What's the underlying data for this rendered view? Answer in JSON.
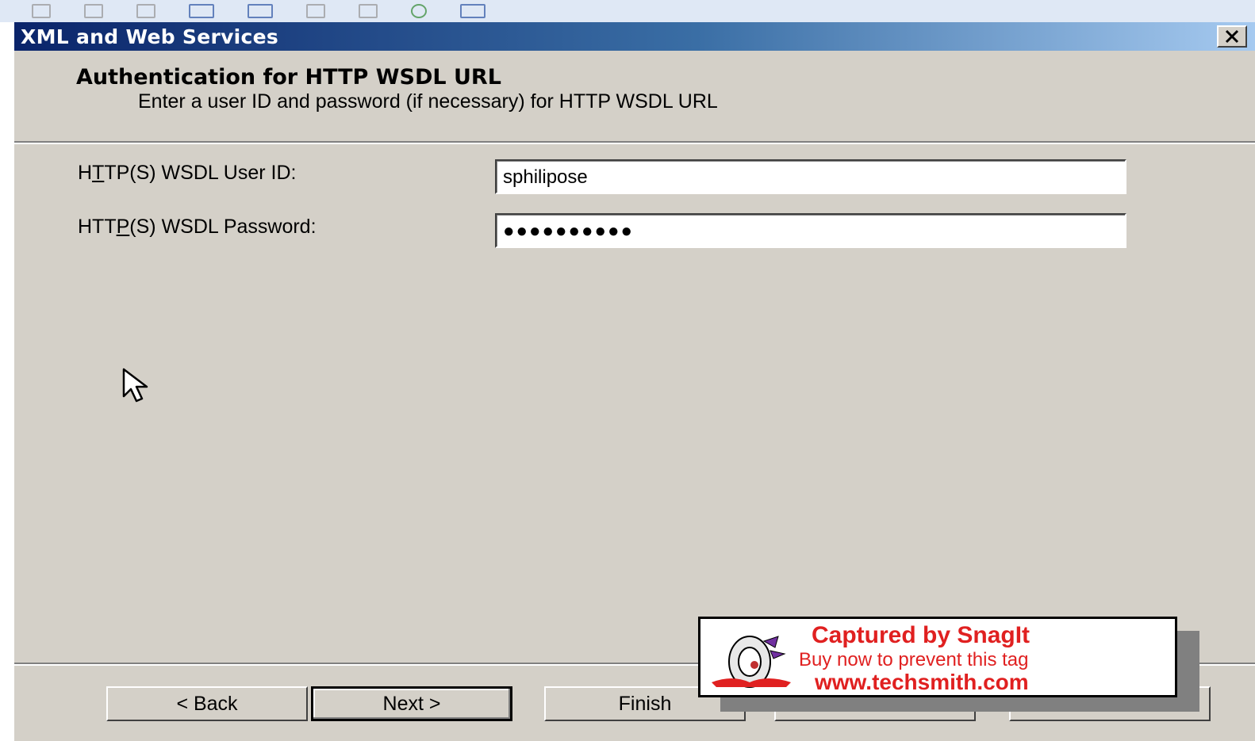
{
  "window": {
    "title": "XML and Web Services",
    "close_label": "✕"
  },
  "header": {
    "heading": "Authentication for HTTP WSDL URL",
    "subheading": "Enter a user ID and password (if necessary) for HTTP WSDL URL"
  },
  "form": {
    "user_id": {
      "label_pre": "H",
      "label_mnemonic": "T",
      "label_post": "TP(S) WSDL User ID:",
      "value": "sphilipose"
    },
    "password": {
      "label_pre": "HTT",
      "label_mnemonic": "P",
      "label_post": "(S) WSDL Password:",
      "masked_value": "●●●●●●●●●●"
    }
  },
  "buttons": {
    "back": "< Back",
    "next": "Next >",
    "finish": "Finish",
    "cancel": "",
    "help": ""
  },
  "watermark": {
    "line1": "Captured by SnagIt",
    "line2": "Buy now to prevent this tag",
    "line3": "www.techsmith.com",
    "accent": "#e02020"
  },
  "icons": [
    "toolbar-icon",
    "close-icon",
    "cursor-icon",
    "snagit-logo-icon"
  ]
}
